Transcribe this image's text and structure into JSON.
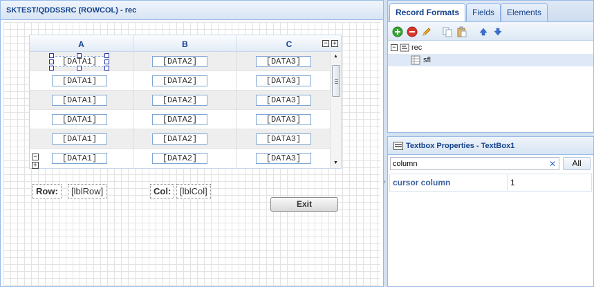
{
  "designer": {
    "title": "SKTEST/QDDSSRC (ROWCOL) - rec",
    "grid": {
      "columns": [
        "A",
        "B",
        "C"
      ],
      "rows": [
        [
          "[DATA1]",
          "[DATA2]",
          "[DATA3]"
        ],
        [
          "[DATA1]",
          "[DATA2]",
          "[DATA3]"
        ],
        [
          "[DATA1]",
          "[DATA2]",
          "[DATA3]"
        ],
        [
          "[DATA1]",
          "[DATA2]",
          "[DATA3]"
        ],
        [
          "[DATA1]",
          "[DATA2]",
          "[DATA3]"
        ],
        [
          "[DATA1]",
          "[DATA2]",
          "[DATA3]"
        ]
      ]
    },
    "row_label": "Row:",
    "row_value": "[lblRow]",
    "col_label": "Col:",
    "col_value": "[lblCol]",
    "exit_label": "Exit"
  },
  "tabs": [
    {
      "label": "Record Formats",
      "active": true
    },
    {
      "label": "Fields",
      "active": false
    },
    {
      "label": "Elements",
      "active": false
    }
  ],
  "tree": {
    "root": "rec",
    "child": "sfl"
  },
  "properties": {
    "title": "Textbox Properties - TextBox1",
    "filter_value": "column",
    "all_label": "All",
    "rows": [
      {
        "name": "cursor column",
        "value": "1"
      }
    ]
  },
  "colors": {
    "accent": "#15428b",
    "border": "#99bbe8",
    "add_green": "#3aa335",
    "delete_red": "#d9372b"
  }
}
